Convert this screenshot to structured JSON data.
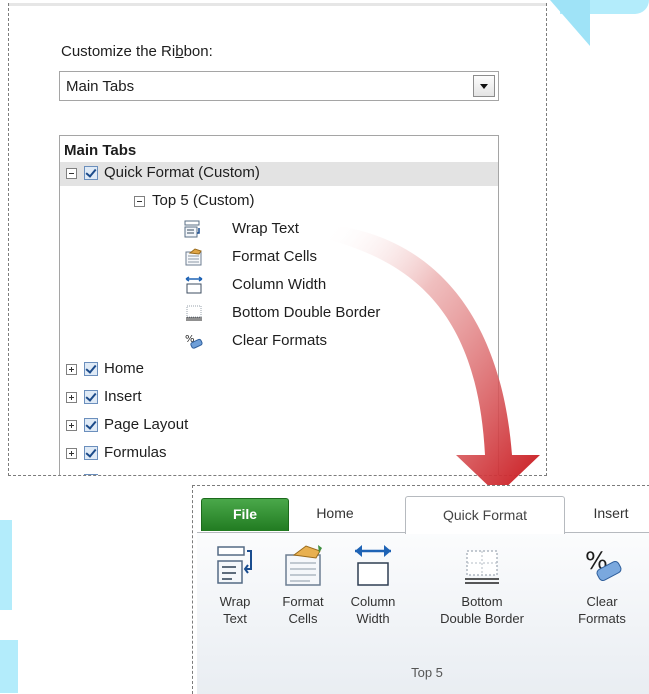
{
  "customize": {
    "label_prefix": "Customize the Ri",
    "label_accel": "b",
    "label_suffix": "bon:",
    "dropdown_value": "Main Tabs"
  },
  "tree": {
    "header": "Main Tabs",
    "custom_tab": "Quick Format (Custom)",
    "custom_group": "Top 5 (Custom)",
    "commands": [
      {
        "label": "Wrap Text",
        "icon": "wrap-text-icon"
      },
      {
        "label": "Format Cells",
        "icon": "format-cells-icon"
      },
      {
        "label": "Column Width",
        "icon": "column-width-icon"
      },
      {
        "label": "Bottom Double Border",
        "icon": "bottom-double-border-icon"
      },
      {
        "label": "Clear Formats",
        "icon": "clear-formats-icon"
      }
    ],
    "tabs": [
      "Home",
      "Insert",
      "Page Layout",
      "Formulas"
    ]
  },
  "ribbon": {
    "tabs": [
      "File",
      "Home",
      "Quick Format",
      "Insert"
    ],
    "active_tab": "Quick Format",
    "buttons": [
      {
        "line1": "Wrap",
        "line2": "Text",
        "icon": "wrap-text-icon"
      },
      {
        "line1": "Format",
        "line2": "Cells",
        "icon": "format-cells-icon"
      },
      {
        "line1": "Column",
        "line2": "Width",
        "icon": "column-width-icon"
      },
      {
        "line1": "Bottom",
        "line2": "Double Border",
        "icon": "bottom-double-border-icon"
      },
      {
        "line1": "Clear",
        "line2": "Formats",
        "icon": "clear-formats-icon"
      }
    ],
    "group_name": "Top 5"
  },
  "colors": {
    "file_tab": "#217b21",
    "arrow": "#c8141a",
    "checkbox": "#1c4b8a"
  }
}
